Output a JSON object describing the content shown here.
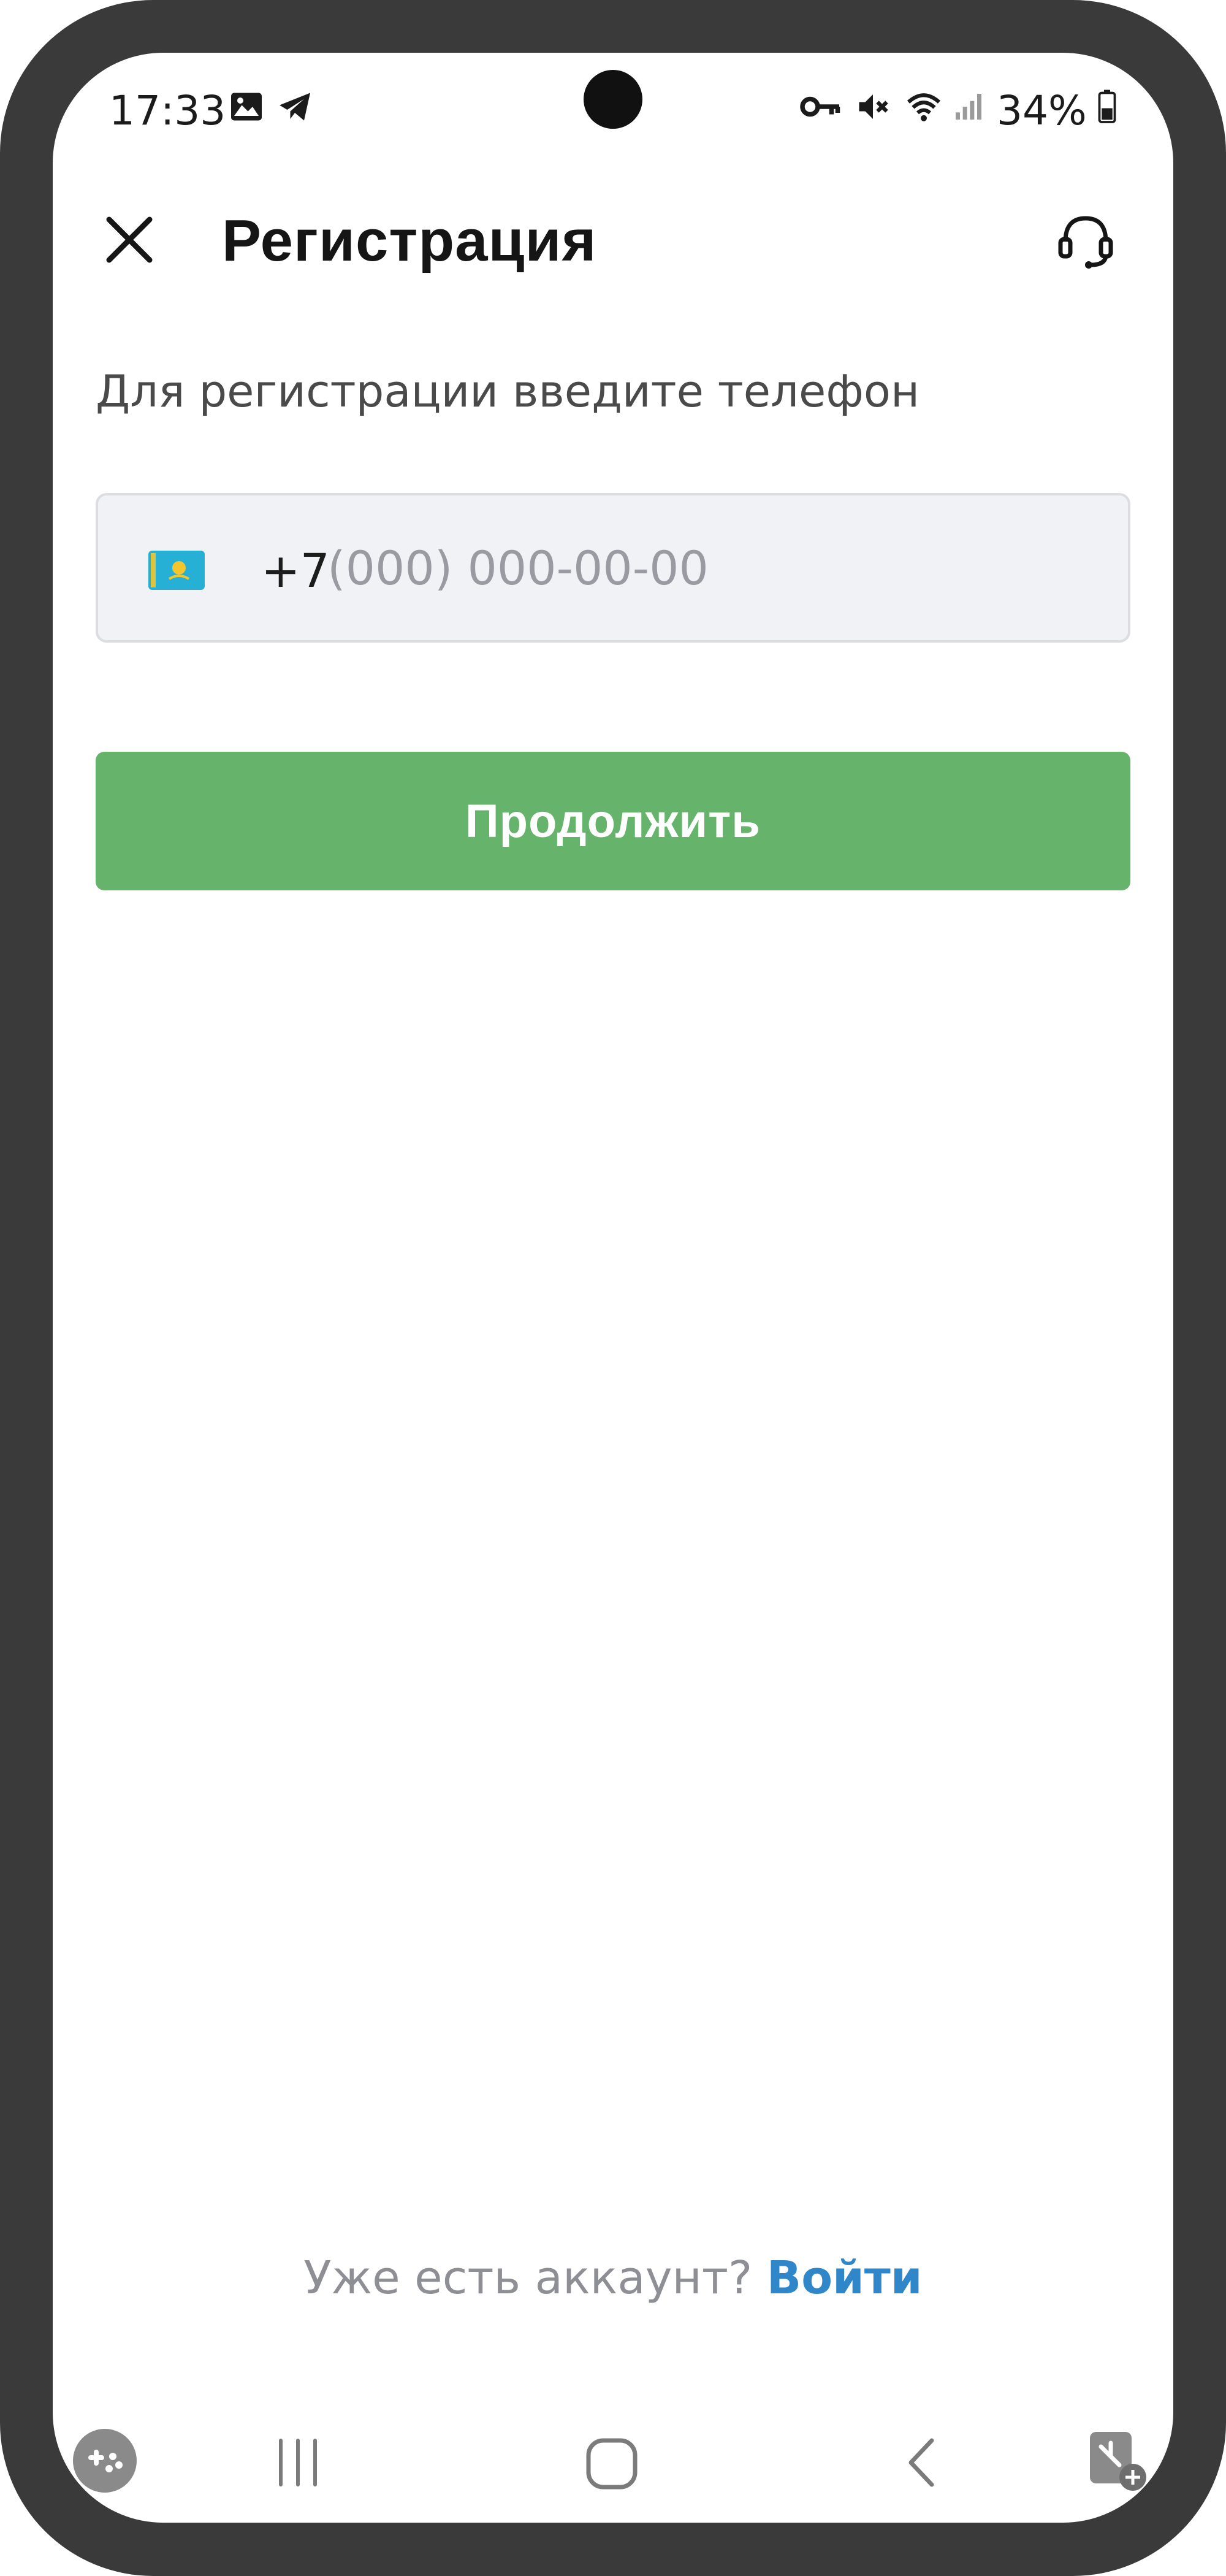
{
  "status_bar": {
    "time": "17:33",
    "battery": "34%",
    "icons": [
      "image-icon",
      "telegram-icon",
      "key-icon",
      "mute-icon",
      "wifi-icon",
      "signal-icon",
      "battery-icon"
    ]
  },
  "header": {
    "title": "Регистрация",
    "close_icon": "close-icon",
    "support_icon": "headset-icon"
  },
  "form": {
    "instruction": "Для регистрации введите телефон",
    "country_code": "+7",
    "phone_value": "",
    "phone_placeholder": "(000) 000-00-00",
    "flag_icon": "kazakhstan-flag-icon",
    "continue_label": "Продолжить"
  },
  "footer": {
    "login_prompt": "Уже есть аккаунт?",
    "login_link": "Войти"
  },
  "nav_bar": {
    "icons": [
      "game-launcher-icon",
      "recent-apps-icon",
      "home-icon",
      "back-icon",
      "screenshot-tool-icon"
    ]
  },
  "colors": {
    "accent_green": "#66b36b",
    "link_blue": "#2f86c8",
    "field_bg": "#f1f2f5",
    "frame": "#3a3a3a"
  }
}
